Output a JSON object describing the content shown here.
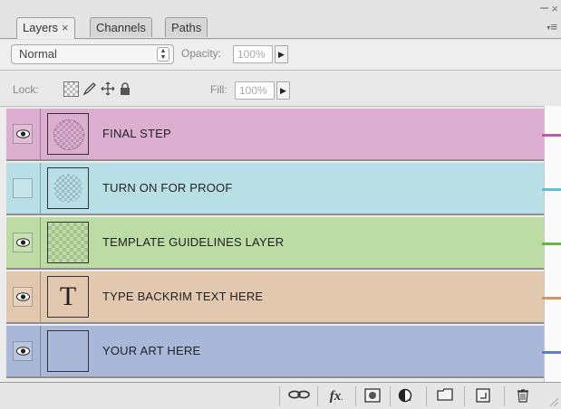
{
  "tabs": [
    {
      "label": "Layers",
      "close": "×",
      "active": true
    },
    {
      "label": "Channels",
      "active": false
    },
    {
      "label": "Paths",
      "active": false
    }
  ],
  "window": {
    "minimize": "–",
    "close": "×",
    "menu": "≡"
  },
  "blend": {
    "mode": "Normal",
    "opacity_label": "Opacity:",
    "opacity_value": "100%"
  },
  "lock": {
    "label": "Lock:",
    "fill_label": "Fill:",
    "fill_value": "100%"
  },
  "layers": [
    {
      "name": "FINAL STEP",
      "visible": true,
      "thumb": "checker-circle",
      "color": "#dcafd0",
      "mark": "#c15aa6"
    },
    {
      "name": "TURN ON FOR PROOF",
      "visible": false,
      "thumb": "circle",
      "color": "#b9dfe6",
      "mark": "#5fbfd8"
    },
    {
      "name": "TEMPLATE GUIDELINES LAYER",
      "visible": true,
      "thumb": "checker",
      "color": "#bddba5",
      "mark": "#67b640"
    },
    {
      "name": "TYPE BACKRIM TEXT HERE",
      "visible": true,
      "thumb": "T",
      "color": "#e2c8ae",
      "mark": "#d9965a"
    },
    {
      "name": "YOUR ART HERE",
      "visible": true,
      "thumb": "blank",
      "color": "#a9b8d9",
      "mark": "#5d7fc6"
    }
  ],
  "bottom": {
    "fx": "fx"
  }
}
